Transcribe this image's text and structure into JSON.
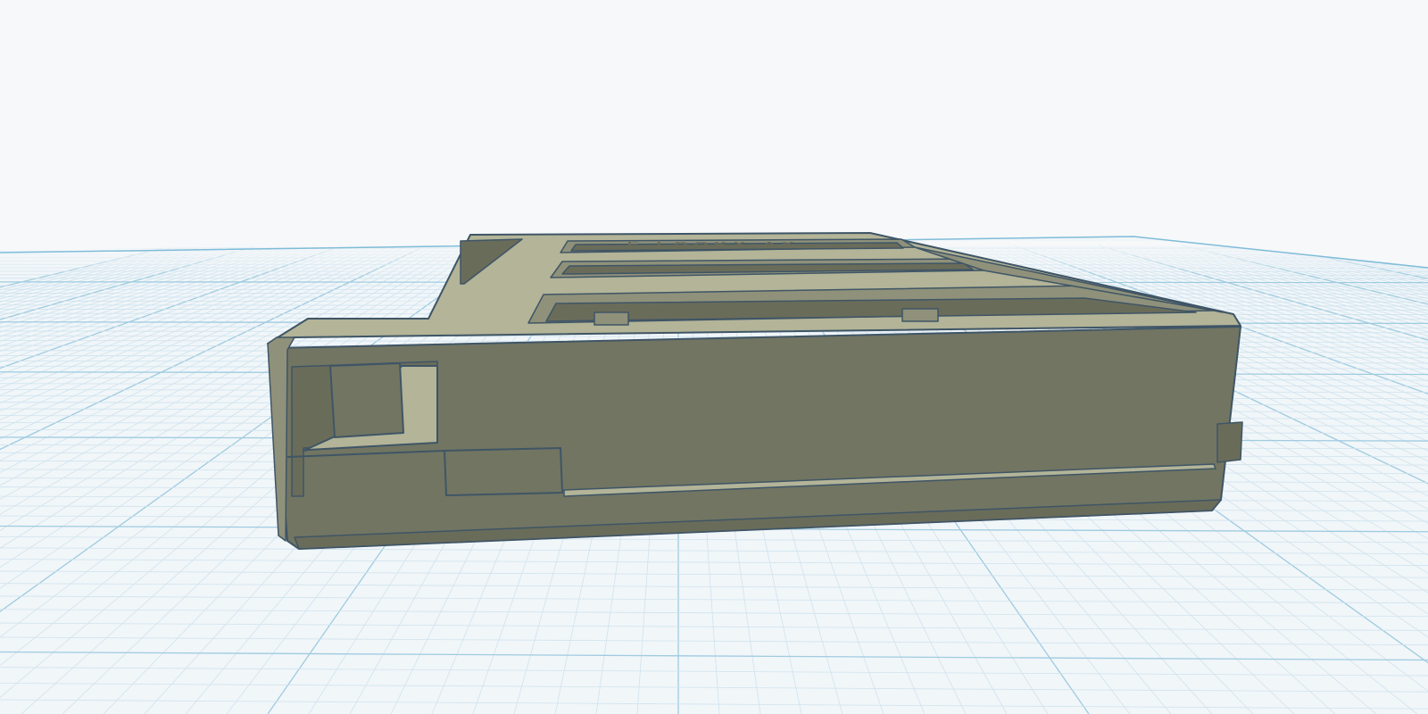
{
  "viewport": {
    "background": "#f6f8fa",
    "grid_minor_color": "#cfe3ee",
    "grid_major_color": "#9fcbe0",
    "workplane_edge_color": "#7fbcd8"
  },
  "model": {
    "body_color": "#727562",
    "top_color": "#b3b498",
    "bevel_color": "#8f917a",
    "inner_shadow_color": "#6a6c5a",
    "edge_color": "#3f5566",
    "engraved_text": "E LOOKY-AK"
  }
}
